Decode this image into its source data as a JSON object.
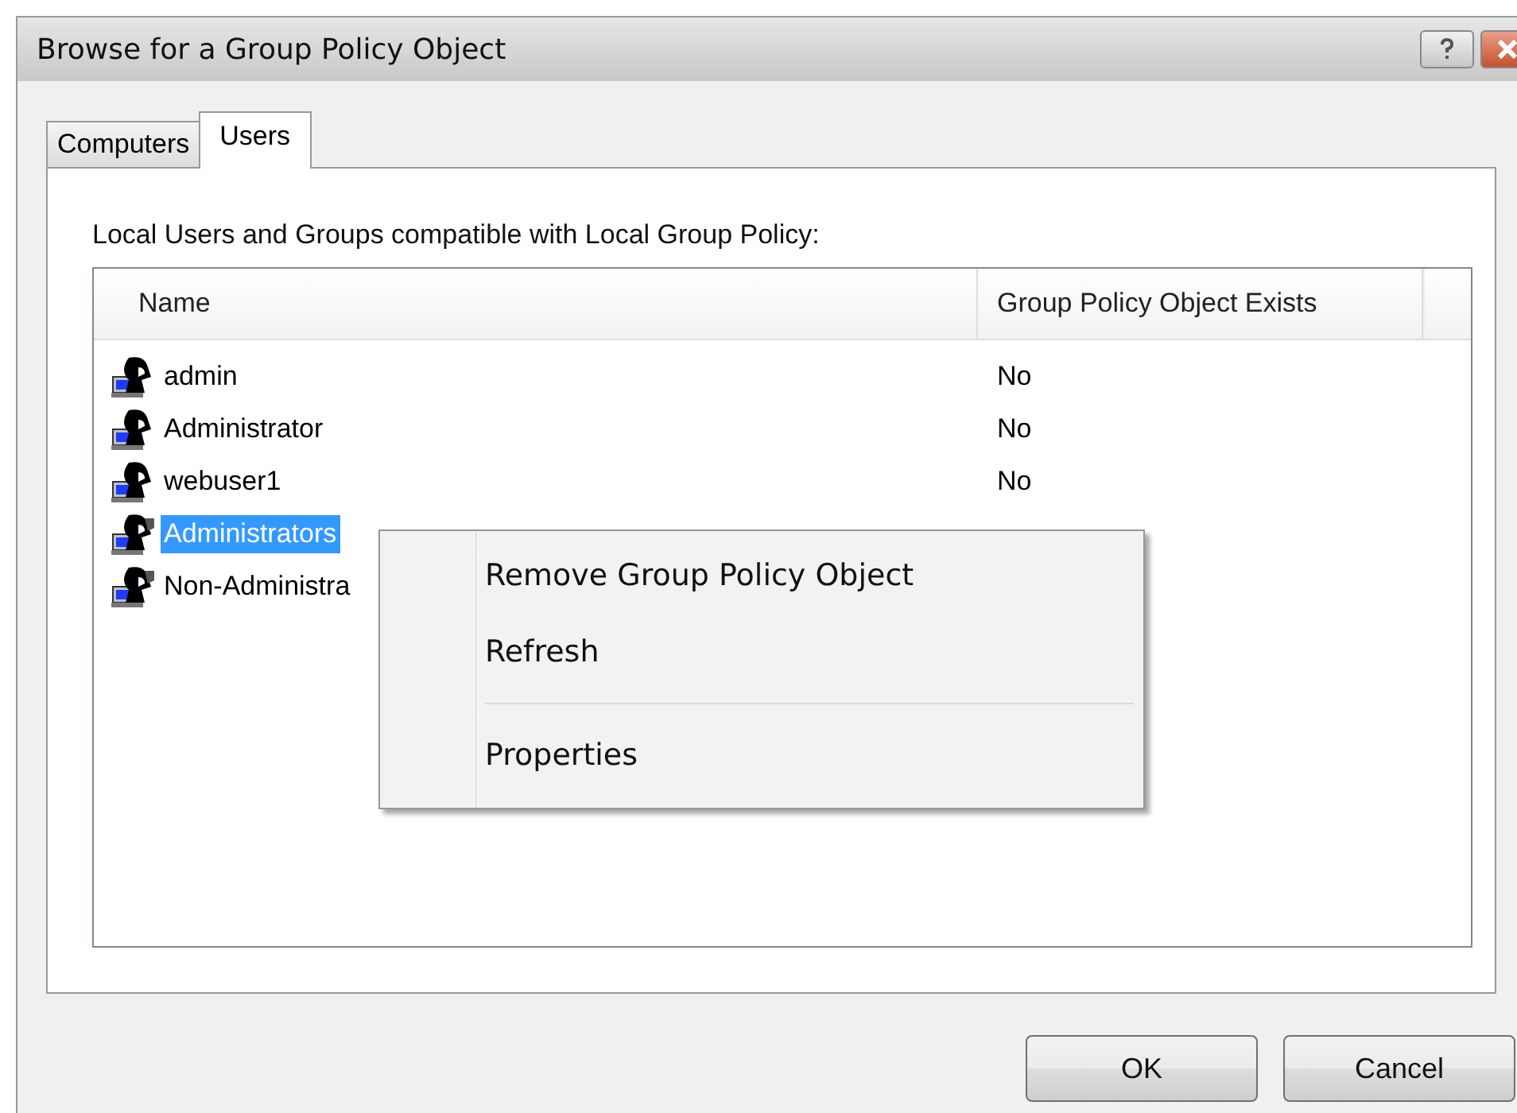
{
  "window": {
    "title": "Browse for a Group Policy Object"
  },
  "tabs": [
    {
      "label": "Computers",
      "selected": false
    },
    {
      "label": "Users",
      "selected": true
    }
  ],
  "list_label": "Local Users and Groups compatible with Local Group Policy:",
  "table": {
    "columns": [
      "Name",
      "Group Policy Object Exists"
    ],
    "rows": [
      {
        "name": "admin",
        "exists": "No",
        "kind": "user",
        "selected": false
      },
      {
        "name": "Administrator",
        "exists": "No",
        "kind": "user",
        "selected": false
      },
      {
        "name": "webuser1",
        "exists": "No",
        "kind": "user",
        "selected": false
      },
      {
        "name": "Administrators",
        "kind": "group",
        "selected": true
      },
      {
        "name": "Non-Administra",
        "kind": "group",
        "selected": false
      }
    ]
  },
  "context_menu": [
    {
      "label": "Remove Group Policy Object",
      "kind": "item"
    },
    {
      "label": "Refresh",
      "kind": "item"
    },
    {
      "kind": "separator"
    },
    {
      "label": "Properties",
      "kind": "item"
    }
  ],
  "buttons": [
    "OK",
    "Cancel"
  ]
}
